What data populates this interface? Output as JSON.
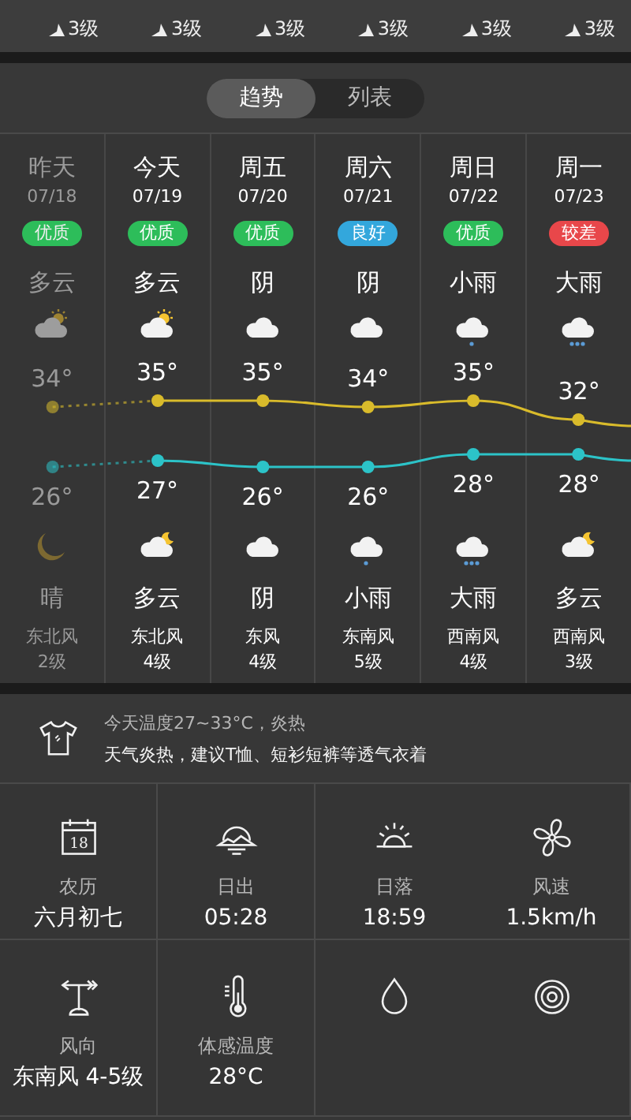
{
  "hours": [
    {
      "wind": "3级"
    },
    {
      "wind": "3级"
    },
    {
      "wind": "3级"
    },
    {
      "wind": "3级"
    },
    {
      "wind": "3级"
    },
    {
      "wind": "3级"
    }
  ],
  "tabs": [
    {
      "label": "趋势",
      "selected": true
    },
    {
      "label": "列表",
      "selected": false
    }
  ],
  "days": [
    {
      "name": "昨天",
      "date": "07/18",
      "past": true,
      "aqi": {
        "text": "优质",
        "color": "#2dbd5a"
      },
      "day": {
        "kind": "partlycloudy",
        "weather": "多云"
      },
      "high": "34°",
      "low": "26°",
      "night": {
        "kind": "moon",
        "weather": "晴"
      },
      "wind_dir": "东北风",
      "wind_level": "2级"
    },
    {
      "name": "今天",
      "date": "07/19",
      "past": false,
      "aqi": {
        "text": "优质",
        "color": "#2dbd5a"
      },
      "day": {
        "kind": "partlycloudy",
        "weather": "多云"
      },
      "high": "35°",
      "low": "27°",
      "night": {
        "kind": "cloudynight",
        "weather": "多云"
      },
      "wind_dir": "东北风",
      "wind_level": "4级"
    },
    {
      "name": "周五",
      "date": "07/20",
      "past": false,
      "aqi": {
        "text": "优质",
        "color": "#2dbd5a"
      },
      "day": {
        "kind": "cloud",
        "weather": "阴"
      },
      "high": "35°",
      "low": "26°",
      "night": {
        "kind": "cloud",
        "weather": "阴"
      },
      "wind_dir": "东风",
      "wind_level": "4级"
    },
    {
      "name": "周六",
      "date": "07/21",
      "past": false,
      "aqi": {
        "text": "良好",
        "color": "#33a7dc"
      },
      "day": {
        "kind": "cloud",
        "weather": "阴"
      },
      "high": "34°",
      "low": "26°",
      "night": {
        "kind": "lightrain",
        "weather": "小雨"
      },
      "wind_dir": "东南风",
      "wind_level": "5级"
    },
    {
      "name": "周日",
      "date": "07/22",
      "past": false,
      "aqi": {
        "text": "优质",
        "color": "#2dbd5a"
      },
      "day": {
        "kind": "lightrain",
        "weather": "小雨"
      },
      "high": "35°",
      "low": "28°",
      "night": {
        "kind": "heavyrain",
        "weather": "大雨"
      },
      "wind_dir": "西南风",
      "wind_level": "4级"
    },
    {
      "name": "周一",
      "date": "07/23",
      "past": false,
      "aqi": {
        "text": "较差",
        "color": "#e8474a"
      },
      "day": {
        "kind": "heavyrain",
        "weather": "大雨"
      },
      "high": "32°",
      "low": "28°",
      "night": {
        "kind": "cloudynight",
        "weather": "多云"
      },
      "wind_dir": "西南风",
      "wind_level": "3级"
    }
  ],
  "tip": {
    "summary": "今天温度27~33°C，炎热",
    "advice": "天气炎热，建议T恤、短衫短裤等透气衣着"
  },
  "details": [
    {
      "kind": "calendar",
      "icon_text": "18",
      "label": "农历",
      "value": "六月初七"
    },
    {
      "kind": "sunrise",
      "label": "日出",
      "value": "05:28"
    },
    {
      "kind": "sunset",
      "label": "日落",
      "value": "18:59"
    },
    {
      "kind": "fan",
      "label": "风速",
      "value": "1.5km/h"
    },
    {
      "kind": "vane",
      "label": "风向",
      "value": "东南风 4-5级"
    },
    {
      "kind": "thermometer",
      "label": "体感温度",
      "value": "28°C"
    },
    {
      "kind": "drop"
    },
    {
      "kind": "rings"
    }
  ]
}
